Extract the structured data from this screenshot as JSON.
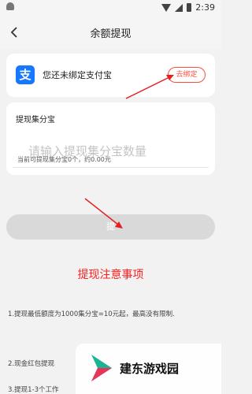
{
  "status_bar": {
    "time": "2:39"
  },
  "header": {
    "title": "余额提现"
  },
  "alipay": {
    "status": "您还未绑定支付宝",
    "bind_label": "去绑定",
    "logo_char": "支"
  },
  "withdraw": {
    "label": "提现集分宝",
    "placeholder": "请输入提现集分宝数量",
    "available": "当前可提现集分宝0个，约0.00元",
    "button_label": "提"
  },
  "notice": {
    "title": "提现注意事项",
    "rules": [
      "1.提现最低额度为1000集分宝=10元起，最高没有限制.",
      "2.现金红包提现",
      "3.提现1-3个工作"
    ]
  },
  "watermark": {
    "text": "建东游戏园"
  },
  "colors": {
    "accent": "#ff1f1f",
    "alipay_blue": "#1677ff",
    "button_disabled": "#d9d9d9"
  }
}
